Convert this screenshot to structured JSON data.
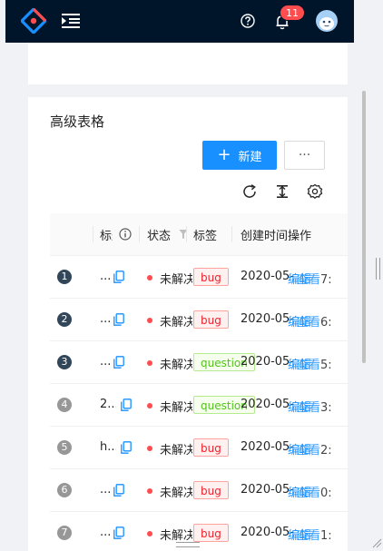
{
  "header": {
    "notification_count": "11",
    "icons": [
      "logo-icon",
      "menu-fold-icon",
      "question-circle-icon",
      "bell-icon",
      "avatar"
    ]
  },
  "table_card": {
    "title": "高级表格",
    "new_button_label": "新建",
    "more_button_label": "···",
    "toolbar_icons": [
      "reload-icon",
      "column-height-icon",
      "setting-icon"
    ],
    "columns": [
      "标题",
      "状态",
      "标签",
      "创建时间",
      "操作"
    ],
    "rows": [
      {
        "index": "1",
        "title": "...",
        "status": "未解决",
        "tag": "bug",
        "tag_type": "bug",
        "created": "2020-05-",
        "time_tail": "7:",
        "op": "编辑",
        "op_tail": "查看"
      },
      {
        "index": "2",
        "title": "...",
        "status": "未解决",
        "tag": "bug",
        "tag_type": "bug",
        "created": "2020-05-",
        "time_tail": "6:",
        "op": "编辑",
        "op_tail": "查看"
      },
      {
        "index": "3",
        "title": "...",
        "status": "未解决",
        "tag": "question",
        "tag_type": "question",
        "created": "2020-05-",
        "time_tail": "5:",
        "op": "编辑",
        "op_tail": "查看"
      },
      {
        "index": "4",
        "title": "2...",
        "status": "未解决",
        "tag": "question",
        "tag_type": "question",
        "created": "2020-05-",
        "time_tail": "3:",
        "op": "编辑",
        "op_tail": "查看"
      },
      {
        "index": "5",
        "title": "h...",
        "status": "未解决",
        "tag": "bug",
        "tag_type": "bug",
        "created": "2020-05-",
        "time_tail": "2:",
        "op": "编辑",
        "op_tail": "查看"
      },
      {
        "index": "6",
        "title": "...",
        "status": "未解决",
        "tag": "bug",
        "tag_type": "bug",
        "created": "2020-05-",
        "time_tail": "0:",
        "op": "编辑",
        "op_tail": "查看"
      },
      {
        "index": "7",
        "title": "...",
        "status": "未解决",
        "tag": "bug",
        "tag_type": "bug",
        "created": "2020-05-",
        "time_tail": "1:",
        "op": "编辑",
        "op_tail": "查看"
      }
    ]
  },
  "colors": {
    "header_bg": "#001529",
    "primary": "#1890ff",
    "danger": "#ff4d4f",
    "index_dark": "#314659",
    "index_light": "#979797"
  }
}
